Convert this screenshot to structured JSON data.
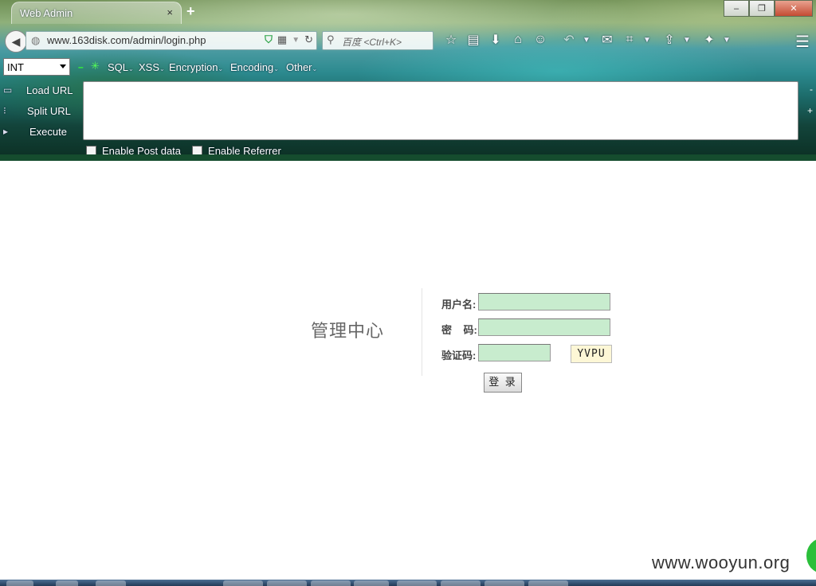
{
  "browser": {
    "tab_title": "Web Admin",
    "tab_close": "×",
    "new_tab": "+",
    "url": "www.163disk.com/admin/login.php",
    "search_placeholder": "百度 <Ctrl+K>",
    "window_controls": {
      "minimize": "–",
      "maximize": "❐",
      "close": "✕"
    }
  },
  "hackbar": {
    "select_value": "INT",
    "menus": [
      "SQL",
      "XSS",
      "Encryption",
      "Encoding",
      "Other"
    ],
    "side": {
      "load_url": "Load URL",
      "split_url": "Split URL",
      "execute": "Execute"
    },
    "enable_post": "Enable Post data",
    "enable_referrer": "Enable Referrer",
    "minus": "-",
    "plus": "+"
  },
  "page": {
    "title": "管理中心",
    "username_label": "用户名:",
    "password_label": "密    码:",
    "captcha_label": "验证码:",
    "captcha_text": "YVPU",
    "login_button": "登 录"
  },
  "watermark": "www.wooyun.org"
}
